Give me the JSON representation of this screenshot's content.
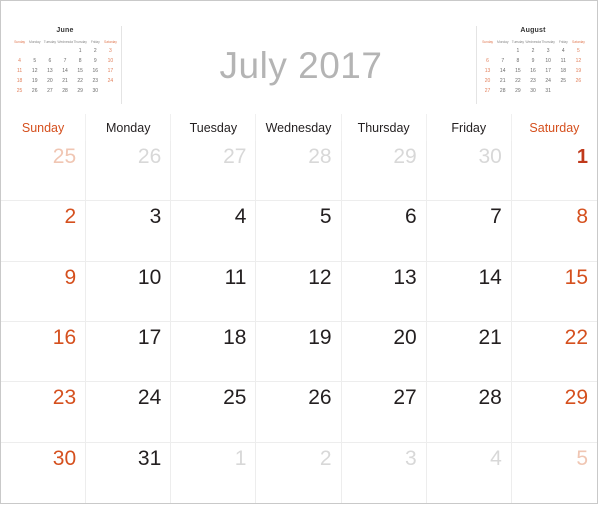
{
  "title": {
    "month_year": "July 2017"
  },
  "colors": {
    "weekend": "#d5501e",
    "weekday": "#231f20",
    "muted": "#d8d8d8",
    "muted_weekend": "#f0c6b3",
    "title": "#b4b4b4",
    "grid_line": "#ededed",
    "border": "#c9c9c9"
  },
  "weekday_headers": [
    {
      "label": "Sunday",
      "weekend": true
    },
    {
      "label": "Monday",
      "weekend": false
    },
    {
      "label": "Tuesday",
      "weekend": false
    },
    {
      "label": "Wednesday",
      "weekend": false
    },
    {
      "label": "Thursday",
      "weekend": false
    },
    {
      "label": "Friday",
      "weekend": false
    },
    {
      "label": "Saturday",
      "weekend": true
    }
  ],
  "days": [
    {
      "n": "25",
      "other": true,
      "weekend": true
    },
    {
      "n": "26",
      "other": true,
      "weekend": false
    },
    {
      "n": "27",
      "other": true,
      "weekend": false
    },
    {
      "n": "28",
      "other": true,
      "weekend": false
    },
    {
      "n": "29",
      "other": true,
      "weekend": false
    },
    {
      "n": "30",
      "other": true,
      "weekend": false
    },
    {
      "n": "1",
      "other": false,
      "weekend": true,
      "first": true
    },
    {
      "n": "2",
      "other": false,
      "weekend": true
    },
    {
      "n": "3",
      "other": false,
      "weekend": false
    },
    {
      "n": "4",
      "other": false,
      "weekend": false
    },
    {
      "n": "5",
      "other": false,
      "weekend": false
    },
    {
      "n": "6",
      "other": false,
      "weekend": false
    },
    {
      "n": "7",
      "other": false,
      "weekend": false
    },
    {
      "n": "8",
      "other": false,
      "weekend": true
    },
    {
      "n": "9",
      "other": false,
      "weekend": true
    },
    {
      "n": "10",
      "other": false,
      "weekend": false
    },
    {
      "n": "11",
      "other": false,
      "weekend": false
    },
    {
      "n": "12",
      "other": false,
      "weekend": false
    },
    {
      "n": "13",
      "other": false,
      "weekend": false
    },
    {
      "n": "14",
      "other": false,
      "weekend": false
    },
    {
      "n": "15",
      "other": false,
      "weekend": true
    },
    {
      "n": "16",
      "other": false,
      "weekend": true
    },
    {
      "n": "17",
      "other": false,
      "weekend": false
    },
    {
      "n": "18",
      "other": false,
      "weekend": false
    },
    {
      "n": "19",
      "other": false,
      "weekend": false
    },
    {
      "n": "20",
      "other": false,
      "weekend": false
    },
    {
      "n": "21",
      "other": false,
      "weekend": false
    },
    {
      "n": "22",
      "other": false,
      "weekend": true
    },
    {
      "n": "23",
      "other": false,
      "weekend": true
    },
    {
      "n": "24",
      "other": false,
      "weekend": false
    },
    {
      "n": "25",
      "other": false,
      "weekend": false
    },
    {
      "n": "26",
      "other": false,
      "weekend": false
    },
    {
      "n": "27",
      "other": false,
      "weekend": false
    },
    {
      "n": "28",
      "other": false,
      "weekend": false
    },
    {
      "n": "29",
      "other": false,
      "weekend": true
    },
    {
      "n": "30",
      "other": false,
      "weekend": true
    },
    {
      "n": "31",
      "other": false,
      "weekend": false
    },
    {
      "n": "1",
      "other": true,
      "weekend": false
    },
    {
      "n": "2",
      "other": true,
      "weekend": false
    },
    {
      "n": "3",
      "other": true,
      "weekend": false
    },
    {
      "n": "4",
      "other": true,
      "weekend": false
    },
    {
      "n": "5",
      "other": true,
      "weekend": true
    }
  ],
  "mini_calendars": [
    {
      "id": "june",
      "title": "June",
      "dow": [
        "Sunday",
        "Monday",
        "Tuesday",
        "Wednesday",
        "Thursday",
        "Friday",
        "Saturday"
      ],
      "days": [
        "",
        "",
        "",
        "",
        "1",
        "2",
        "3",
        "4",
        "5",
        "6",
        "7",
        "8",
        "9",
        "10",
        "11",
        "12",
        "13",
        "14",
        "15",
        "16",
        "17",
        "18",
        "19",
        "20",
        "21",
        "22",
        "23",
        "24",
        "25",
        "26",
        "27",
        "28",
        "29",
        "30",
        ""
      ]
    },
    {
      "id": "august",
      "title": "August",
      "dow": [
        "Sunday",
        "Monday",
        "Tuesday",
        "Wednesday",
        "Thursday",
        "Friday",
        "Saturday"
      ],
      "days": [
        "",
        "",
        "1",
        "2",
        "3",
        "4",
        "5",
        "6",
        "7",
        "8",
        "9",
        "10",
        "11",
        "12",
        "13",
        "14",
        "15",
        "16",
        "17",
        "18",
        "19",
        "20",
        "21",
        "22",
        "23",
        "24",
        "25",
        "26",
        "27",
        "28",
        "29",
        "30",
        "31",
        "",
        ""
      ]
    }
  ]
}
